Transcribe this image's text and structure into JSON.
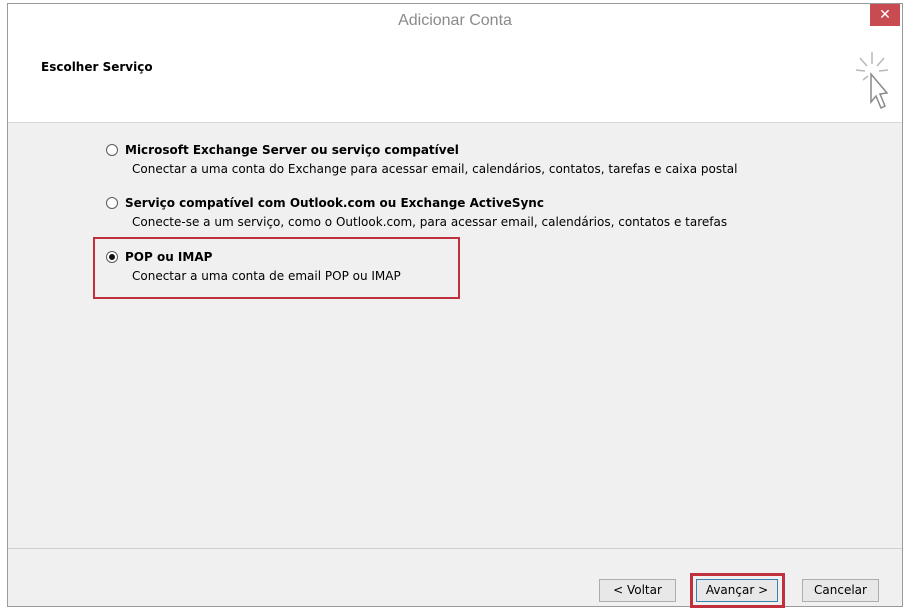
{
  "window": {
    "title": "Adicionar Conta",
    "close_label": "✕"
  },
  "header": {
    "title": "Escolher Serviço",
    "icon": "cursor-click-icon"
  },
  "options": [
    {
      "label": "Microsoft Exchange Server ou serviço compatível",
      "description": "Conectar a uma conta do Exchange para acessar email, calendários, contatos, tarefas e caixa postal",
      "selected": false
    },
    {
      "label": "Serviço compatível com Outlook.com ou Exchange ActiveSync",
      "description": "Conecte-se a um serviço, como o Outlook.com, para acessar email, calendários, contatos e tarefas",
      "selected": false
    },
    {
      "label": "POP ou IMAP",
      "description": "Conectar a uma conta de email POP ou IMAP",
      "selected": true
    }
  ],
  "footer": {
    "back_label": "< Voltar",
    "next_label": "Avançar >",
    "cancel_label": "Cancelar"
  },
  "colors": {
    "highlight": "#c0303d",
    "close": "#c74b50"
  }
}
